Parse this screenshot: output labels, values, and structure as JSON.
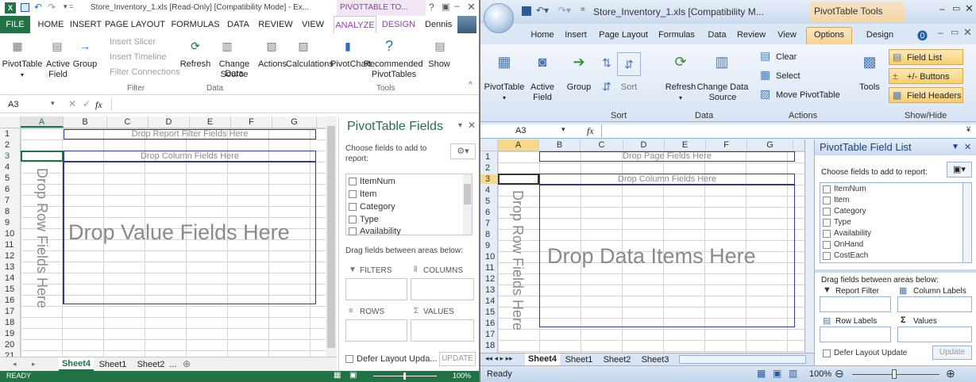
{
  "w1": {
    "title": "Store_Inventory_1.xls  [Read-Only]  [Compatibility Mode] - Ex...",
    "ctx_title": "PIVOTTABLE TO...",
    "tabs": [
      "FILE",
      "HOME",
      "INSERT",
      "PAGE LAYOUT",
      "FORMULAS",
      "DATA",
      "REVIEW",
      "VIEW",
      "ANALYZE",
      "DESIGN"
    ],
    "user": "Dennis",
    "ribbon": {
      "pivottable": "PivotTable",
      "active_field": "Active",
      "active_field2": "Field",
      "group": "Group",
      "insert_slicer": "Insert Slicer",
      "insert_timeline": "Insert Timeline",
      "filter_connections": "Filter Connections",
      "refresh": "Refresh",
      "change_source": "Change Data",
      "change_source2": "Source",
      "actions": "Actions",
      "calculations": "Calculations",
      "pivotchart": "PivotChart",
      "recommended": "Recommended",
      "recommended2": "PivotTables",
      "show": "Show",
      "grp_filter": "Filter",
      "grp_data": "Data",
      "grp_tools": "Tools"
    },
    "namebox": "A3",
    "fx": "fx",
    "cols": [
      "A",
      "B",
      "C",
      "D",
      "E",
      "F",
      "G"
    ],
    "rows": [
      "1",
      "2",
      "3",
      "4",
      "5",
      "6",
      "7",
      "8",
      "9",
      "10",
      "11",
      "12",
      "13",
      "14",
      "15",
      "16",
      "17",
      "18",
      "19",
      "20",
      "21"
    ],
    "drop_filter": "Drop Report Filter Fields Here",
    "drop_column": "Drop Column Fields Here",
    "drop_row": "Drop Row Fields Here",
    "drop_value": "Drop Value Fields Here",
    "sheets": [
      "Sheet4",
      "Sheet1",
      "Sheet2",
      "..."
    ],
    "status": "READY",
    "zoom": "100%",
    "pane": {
      "title": "PivotTable Fields",
      "choose": "Choose fields to add to report:",
      "fields": [
        "ItemNum",
        "Item",
        "Category",
        "Type",
        "Availability"
      ],
      "drag": "Drag fields between areas below:",
      "filters": "FILTERS",
      "columns": "COLUMNS",
      "rows": "ROWS",
      "values": "VALUES",
      "defer": "Defer Layout Upda...",
      "update": "UPDATE"
    }
  },
  "w2": {
    "title": "Store_Inventory_1.xls  [Compatibility M...",
    "ctx_title": "PivotTable Tools",
    "tabs": [
      "Home",
      "Insert",
      "Page Layout",
      "Formulas",
      "Data",
      "Review",
      "View",
      "Options",
      "Design"
    ],
    "ribbon": {
      "pivottable": "PivotTable",
      "active_field": "Active",
      "active_field2": "Field",
      "group": "Group",
      "sort": "Sort",
      "refresh": "Refresh",
      "change_source": "Change Data",
      "change_source2": "Source",
      "clear": "Clear",
      "select": "Select",
      "move": "Move PivotTable",
      "tools": "Tools",
      "field_list": "Field List",
      "buttons": "+/- Buttons",
      "field_headers": "Field Headers",
      "grp_sort": "Sort",
      "grp_data": "Data",
      "grp_actions": "Actions",
      "grp_showhide": "Show/Hide"
    },
    "namebox": "A3",
    "fx": "fx",
    "cols": [
      "A",
      "B",
      "C",
      "D",
      "E",
      "F",
      "G"
    ],
    "rows": [
      "1",
      "2",
      "3",
      "4",
      "5",
      "6",
      "7",
      "8",
      "9",
      "10",
      "11",
      "12",
      "13",
      "14",
      "15",
      "16",
      "17",
      "18"
    ],
    "drop_page": "Drop Page Fields Here",
    "drop_column": "Drop Column Fields Here",
    "drop_row": "Drop Row Fields Here",
    "drop_data": "Drop Data Items Here",
    "sheets": [
      "Sheet4",
      "Sheet1",
      "Sheet2",
      "Sheet3"
    ],
    "status": "Ready",
    "zoom": "100%",
    "pane": {
      "title": "PivotTable Field List",
      "choose": "Choose fields to add to report:",
      "fields": [
        "ItemNum",
        "Item",
        "Category",
        "Type",
        "Availability",
        "OnHand",
        "CostEach"
      ],
      "drag": "Drag fields between areas below:",
      "report_filter": "Report Filter",
      "column_labels": "Column Labels",
      "row_labels": "Row Labels",
      "values": "Values",
      "defer": "Defer Layout Update",
      "update": "Update"
    }
  },
  "colors": {
    "excel2013_green": "#217346",
    "ribbon2007_blue": "#dce7f5",
    "zone_border": "#2e3a8c",
    "orange_highlight": "#fcd77f"
  }
}
